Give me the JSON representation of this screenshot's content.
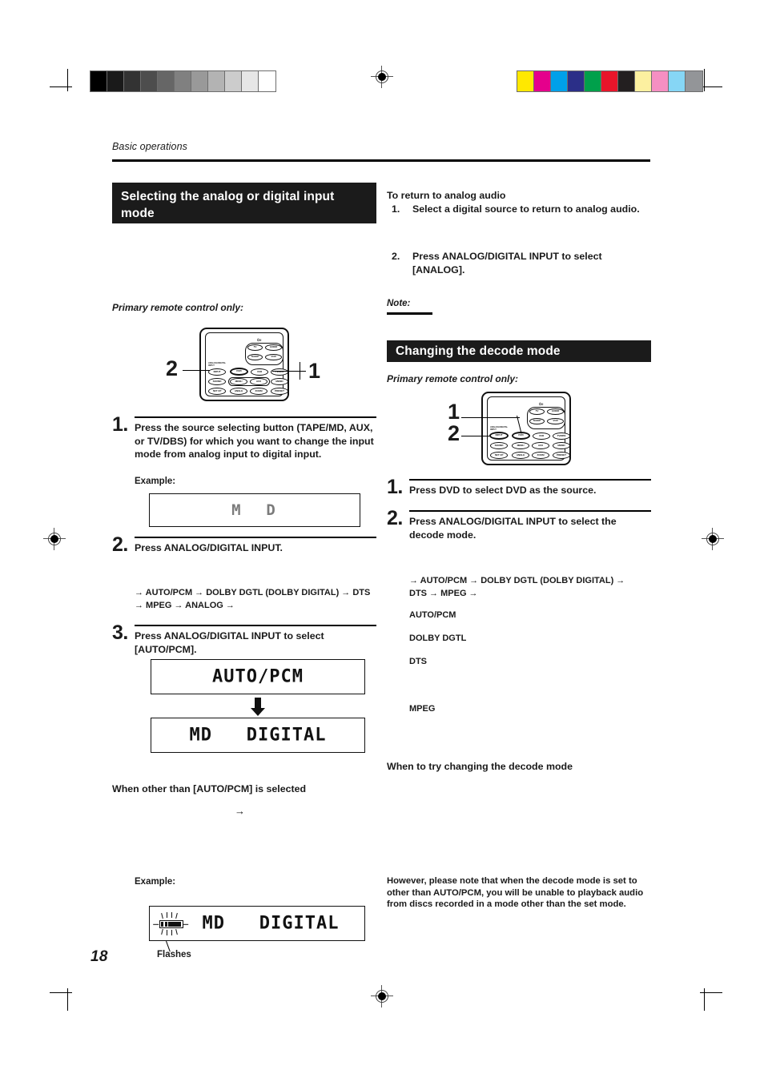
{
  "page": {
    "running_head": "Basic operations",
    "page_number": "18"
  },
  "print_marks": {
    "grayscale_bar": [
      "#000000",
      "#1a1a1a",
      "#333333",
      "#4d4d4d",
      "#666666",
      "#808080",
      "#999999",
      "#b3b3b3",
      "#cccccc",
      "#e6e6e6",
      "#ffffff"
    ],
    "color_bar": [
      "#ffe800",
      "#e5008c",
      "#00a0e9",
      "#2b2f88",
      "#00a04b",
      "#e8152a",
      "#231f20",
      "#fcf0a0",
      "#f58fc2",
      "#86d6f5",
      "#939598"
    ],
    "registration_mark": "registration-target"
  },
  "left_column": {
    "section_title_line1": "Selecting the analog or digital input",
    "section_title_line2": "mode",
    "remote_caption": "Primary remote control only:",
    "callout_left": "2",
    "callout_right": "1",
    "step1": {
      "number": "1.",
      "text": "Press the source selecting button (TAPE/MD, AUX, or TV/DBS) for which you want to change the input mode from analog input to digital input."
    },
    "example1_label": "Example:",
    "display1": "M  D",
    "step2": {
      "number": "2.",
      "text": "Press ANALOG/DIGITAL INPUT."
    },
    "mode_chain": "→ AUTO/PCM → DOLBY DGTL (DOLBY DIGITAL) → DTS → MPEG → ANALOG →",
    "step3": {
      "number": "3.",
      "text": "Press ANALOG/DIGITAL INPUT to select [AUTO/PCM]."
    },
    "display2": "AUTO/PCM",
    "display3": "MD   DIGITAL",
    "other_than_heading": "When other than [AUTO/PCM] is selected",
    "stray_arrow": "→",
    "example2_label": "Example:",
    "display4": "MD   DIGITAL",
    "flashes_label": "Flashes"
  },
  "right_column": {
    "return_heading": "To return to analog audio",
    "return_step1": {
      "number": "1.",
      "text": "Select a digital source to return to analog audio."
    },
    "return_step2": {
      "number": "2.",
      "text": "Press ANALOG/DIGITAL INPUT to select [ANALOG]."
    },
    "note_label": "Note:",
    "section_title": "Changing the decode mode",
    "remote_caption": "Primary remote control only:",
    "callout_top": "1",
    "callout_bottom": "2",
    "step1": {
      "number": "1.",
      "text": "Press DVD to select DVD as the source."
    },
    "step2": {
      "number": "2.",
      "text": "Press ANALOG/DIGITAL INPUT to select the decode mode."
    },
    "mode_chain": "→ AUTO/PCM → DOLBY DGTL (DOLBY DIGITAL) → DTS → MPEG →",
    "modes": [
      "AUTO/PCM",
      "DOLBY DGTL",
      "DTS",
      "MPEG"
    ],
    "when_heading": "When to try changing the decode mode",
    "however_text": "However, please note that when the decode mode is set to other than AUTO/PCM, you will be unable to playback audio from discs recorded in a mode other than the set mode."
  },
  "remote_buttons": {
    "power_glyph": "⏻/I",
    "rows": [
      [
        "TV",
        "AUDIO"
      ],
      [
        "SLEEP",
        "VCR"
      ],
      [
        "ANALOG/DIGITAL INPUT",
        "DVD",
        "VCR",
        "TV/DBS"
      ],
      [
        "SOUND",
        "MENU",
        "AUX",
        "MEMO"
      ],
      [
        "SET UP",
        "ANGLE",
        "ZOOM",
        "PRESET"
      ]
    ],
    "analog_digital_label": "ANALOG/DIGITAL INPUT"
  }
}
